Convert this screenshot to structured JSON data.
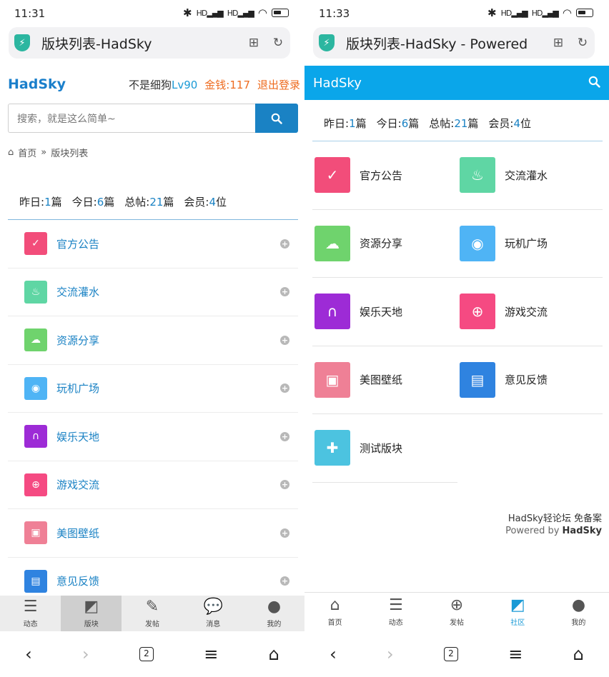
{
  "left": {
    "status": {
      "time": "11:31",
      "sig": "HD"
    },
    "address": {
      "url": "版块列表-HadSky"
    },
    "header": {
      "logo": "HadSky",
      "username": "不是细狗",
      "level": "Lv90",
      "money": "金钱:117",
      "logout": "退出登录"
    },
    "search": {
      "placeholder": "搜索，就是这么简单~"
    },
    "breadcrumb": {
      "home": "首页",
      "sep": "»",
      "current": "版块列表"
    },
    "stats": {
      "yesterday_label": "昨日:",
      "yesterday": "1",
      "today_label": "今日:",
      "today": "6",
      "total_label": "总帖:",
      "total": "21",
      "members_label": "会员:",
      "members": "4",
      "unit_posts": "篇",
      "unit_members": "位"
    },
    "boards": [
      {
        "label": "官方公告",
        "color": "#f24d7a",
        "icon": "calendar-check-icon"
      },
      {
        "label": "交流灌水",
        "color": "#5fd6a4",
        "icon": "flame-icon"
      },
      {
        "label": "资源分享",
        "color": "#6fd36d",
        "icon": "cloud-download-icon"
      },
      {
        "label": "玩机广场",
        "color": "#4fb4f5",
        "icon": "android-icon"
      },
      {
        "label": "娱乐天地",
        "color": "#9d2bd6",
        "icon": "headphones-icon"
      },
      {
        "label": "游戏交流",
        "color": "#f54a82",
        "icon": "gamepad-icon"
      },
      {
        "label": "美图壁纸",
        "color": "#ef8096",
        "icon": "image-icon"
      },
      {
        "label": "意见反馈",
        "color": "#2f83e0",
        "icon": "document-icon"
      }
    ],
    "tabbar": [
      {
        "label": "动态",
        "icon": "list-icon"
      },
      {
        "label": "版块",
        "icon": "board-icon"
      },
      {
        "label": "发帖",
        "icon": "edit-icon"
      },
      {
        "label": "消息",
        "icon": "chat-icon"
      },
      {
        "label": "我的",
        "icon": "user-icon"
      }
    ],
    "sysnav": {
      "tabs": "2"
    }
  },
  "right": {
    "status": {
      "time": "11:33",
      "sig": "HD"
    },
    "address": {
      "url": "版块列表-HadSky - Powered"
    },
    "header": {
      "logo": "HadSky"
    },
    "stats": {
      "yesterday_label": "昨日:",
      "yesterday": "1",
      "today_label": "今日:",
      "today": "6",
      "total_label": "总帖:",
      "total": "21",
      "members_label": "会员:",
      "members": "4",
      "unit_posts": "篇",
      "unit_members": "位"
    },
    "boards": [
      {
        "label": "官方公告",
        "color": "#f24d7a",
        "icon": "calendar-check-icon"
      },
      {
        "label": "交流灌水",
        "color": "#5fd6a4",
        "icon": "flame-icon"
      },
      {
        "label": "资源分享",
        "color": "#6fd36d",
        "icon": "cloud-download-icon"
      },
      {
        "label": "玩机广场",
        "color": "#4fb4f5",
        "icon": "android-icon"
      },
      {
        "label": "娱乐天地",
        "color": "#9d2bd6",
        "icon": "headphones-icon"
      },
      {
        "label": "游戏交流",
        "color": "#f54a82",
        "icon": "gamepad-icon"
      },
      {
        "label": "美图壁纸",
        "color": "#ef8096",
        "icon": "image-icon"
      },
      {
        "label": "意见反馈",
        "color": "#2f83e0",
        "icon": "document-icon"
      },
      {
        "label": "测试版块",
        "color": "#4cc3e0",
        "icon": "puzzle-icon"
      }
    ],
    "footer": {
      "line1": "HadSky轻论坛  免备案",
      "powered": "Powered by ",
      "brand": "HadSky"
    },
    "tabbar": [
      {
        "label": "首页",
        "icon": "home-icon"
      },
      {
        "label": "动态",
        "icon": "list-icon"
      },
      {
        "label": "发帖",
        "icon": "plus-circle-icon"
      },
      {
        "label": "社区",
        "icon": "board-icon"
      },
      {
        "label": "我的",
        "icon": "user-icon"
      }
    ],
    "sysnav": {
      "tabs": "2"
    }
  }
}
